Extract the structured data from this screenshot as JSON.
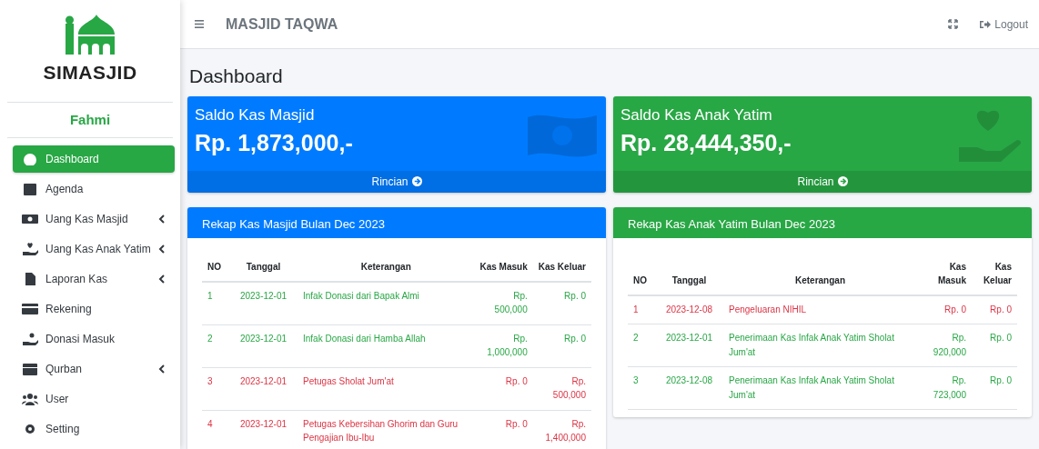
{
  "sidebar": {
    "brand": "SIMASJID",
    "user": "Fahmi",
    "items": [
      {
        "label": "Dashboard",
        "selected": true,
        "expandable": false
      },
      {
        "label": "Agenda",
        "selected": false,
        "expandable": false
      },
      {
        "label": "Uang Kas Masjid",
        "selected": false,
        "expandable": true
      },
      {
        "label": "Uang Kas Anak Yatim",
        "selected": false,
        "expandable": true
      },
      {
        "label": "Laporan Kas",
        "selected": false,
        "expandable": true
      },
      {
        "label": "Rekening",
        "selected": false,
        "expandable": false
      },
      {
        "label": "Donasi Masuk",
        "selected": false,
        "expandable": false
      },
      {
        "label": "Qurban",
        "selected": false,
        "expandable": true
      },
      {
        "label": "User",
        "selected": false,
        "expandable": false
      },
      {
        "label": "Setting",
        "selected": false,
        "expandable": false
      }
    ]
  },
  "navbar": {
    "title": "MASJID TAQWA",
    "logout": "Logout"
  },
  "page_title": "Dashboard",
  "panels": [
    {
      "color": "#007bff",
      "saldo_title": "Saldo Kas Masjid",
      "saldo": "Rp. 1,873,000,-",
      "link": "Rincian",
      "rekap_title": "Rekap Kas Masjid Bulan Dec 2023",
      "columns": [
        "NO",
        "Tanggal",
        "Keterangan",
        "Kas Masuk",
        "Kas Keluar"
      ],
      "rows": [
        {
          "kind": "masuk",
          "cells": [
            "1",
            "2023-12-01",
            "Infak Donasi dari Bapak Almi",
            "Rp. 500,000",
            "Rp. 0"
          ]
        },
        {
          "kind": "masuk",
          "cells": [
            "2",
            "2023-12-01",
            "Infak Donasi dari Hamba Allah",
            "Rp. 1,000,000",
            "Rp. 0"
          ]
        },
        {
          "kind": "keluar",
          "cells": [
            "3",
            "2023-12-01",
            "Petugas Sholat Jum'at",
            "Rp. 0",
            "Rp. 500,000"
          ]
        },
        {
          "kind": "keluar",
          "cells": [
            "4",
            "2023-12-01",
            "Petugas Kebersihan Ghorim dan Guru Pengajian Ibu-Ibu",
            "Rp. 0",
            "Rp. 1,400,000"
          ]
        }
      ]
    },
    {
      "color": "#28a745",
      "saldo_title": "Saldo Kas Anak Yatim",
      "saldo": "Rp. 28,444,350,-",
      "link": "Rincian",
      "rekap_title": "Rekap Kas Anak Yatim Bulan Dec 2023",
      "columns": [
        "NO",
        "Tanggal",
        "Keterangan",
        "Kas Masuk",
        "Kas Keluar"
      ],
      "rows": [
        {
          "kind": "keluar",
          "cells": [
            "1",
            "2023-12-08",
            "Pengeluaran NIHIL",
            "Rp. 0",
            "Rp. 0"
          ]
        },
        {
          "kind": "masuk",
          "cells": [
            "2",
            "2023-12-01",
            "Penerimaan Kas Infak Anak Yatim Sholat Jum'at",
            "Rp. 920,000",
            "Rp. 0"
          ]
        },
        {
          "kind": "masuk",
          "cells": [
            "3",
            "2023-12-08",
            "Penerimaan Kas Infak Anak Yatim Sholat Jum'at",
            "Rp. 723,000",
            "Rp. 0"
          ]
        }
      ]
    }
  ]
}
